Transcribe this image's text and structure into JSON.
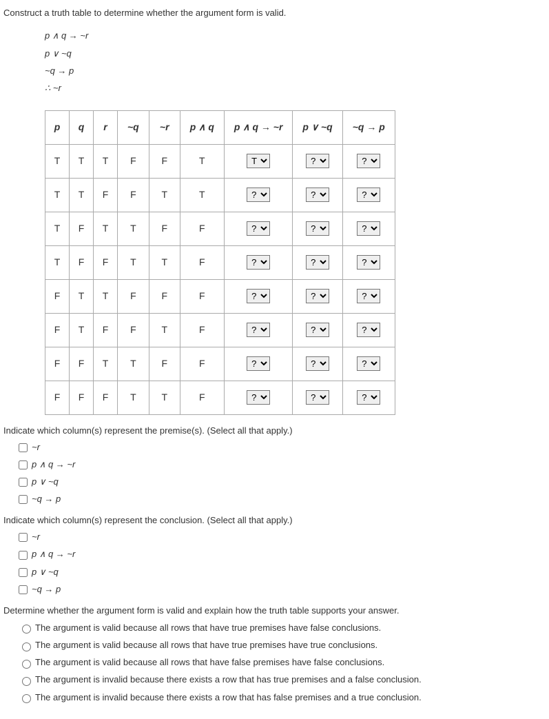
{
  "question": "Construct a truth table to determine whether the argument form is valid.",
  "argument": {
    "line1": "p ∧ q → ~r",
    "line2": "p ∨ ~q",
    "line3": "~q → p",
    "line4": "∴ ~r"
  },
  "headers": {
    "p": "p",
    "q": "q",
    "r": "r",
    "nq": "~q",
    "nr": "~r",
    "pandq": "p ∧ q",
    "pandq_nr": "p ∧ q → ~r",
    "pvnq": "p ∨ ~q",
    "nqp": "~q → p"
  },
  "rows": [
    {
      "p": "T",
      "q": "T",
      "r": "T",
      "nq": "F",
      "nr": "F",
      "pandq": "T",
      "sel": "T"
    },
    {
      "p": "T",
      "q": "T",
      "r": "F",
      "nq": "F",
      "nr": "T",
      "pandq": "T",
      "sel": "?"
    },
    {
      "p": "T",
      "q": "F",
      "r": "T",
      "nq": "T",
      "nr": "F",
      "pandq": "F",
      "sel": "?"
    },
    {
      "p": "T",
      "q": "F",
      "r": "F",
      "nq": "T",
      "nr": "T",
      "pandq": "F",
      "sel": "?"
    },
    {
      "p": "F",
      "q": "T",
      "r": "T",
      "nq": "F",
      "nr": "F",
      "pandq": "F",
      "sel": "?"
    },
    {
      "p": "F",
      "q": "T",
      "r": "F",
      "nq": "F",
      "nr": "T",
      "pandq": "F",
      "sel": "?"
    },
    {
      "p": "F",
      "q": "F",
      "r": "T",
      "nq": "T",
      "nr": "F",
      "pandq": "F",
      "sel": "?"
    },
    {
      "p": "F",
      "q": "F",
      "r": "F",
      "nq": "T",
      "nr": "T",
      "pandq": "F",
      "sel": "?"
    }
  ],
  "select_placeholder": "?",
  "premise_prompt": "Indicate which column(s) represent the premise(s). (Select all that apply.)",
  "conclusion_prompt": "Indicate which column(s) represent the conclusion. (Select all that apply.)",
  "col_options": {
    "a": "~r",
    "b": "p ∧ q → ~r",
    "c": "p ∨ ~q",
    "d": "~q → p"
  },
  "validity_prompt": "Determine whether the argument form is valid and explain how the truth table supports your answer.",
  "validity_options": {
    "a": "The argument is valid because all rows that have true premises have false conclusions.",
    "b": "The argument is valid because all rows that have true premises have true conclusions.",
    "c": "The argument is valid because all rows that have false premises have false conclusions.",
    "d": "The argument is invalid because there exists a row that has true premises and a false conclusion.",
    "e": "The argument is invalid because there exists a row that has false premises and a true conclusion."
  }
}
